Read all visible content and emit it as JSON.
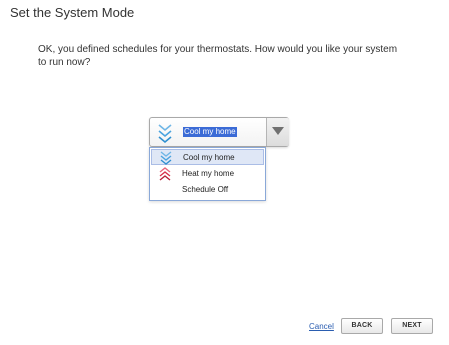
{
  "page": {
    "title": "Set the System Mode",
    "message": "OK, you defined schedules for your thermostats. How would you like your system to run now?"
  },
  "mode_select": {
    "selected_label": "Cool my home",
    "selected_icon": "cool-chevrons-icon",
    "options": [
      {
        "label": "Cool my home",
        "icon": "cool-chevrons-icon",
        "selected": true
      },
      {
        "label": "Heat my home",
        "icon": "heat-chevrons-icon",
        "selected": false
      },
      {
        "label": "Schedule Off",
        "icon": "",
        "selected": false
      }
    ]
  },
  "footer": {
    "cancel_label": "Cancel",
    "back_label": "BACK",
    "next_label": "NEXT"
  },
  "colors": {
    "cool": "#4aa3df",
    "heat": "#d9304a",
    "highlight": "#3b6bd6",
    "link": "#2a5db0"
  }
}
